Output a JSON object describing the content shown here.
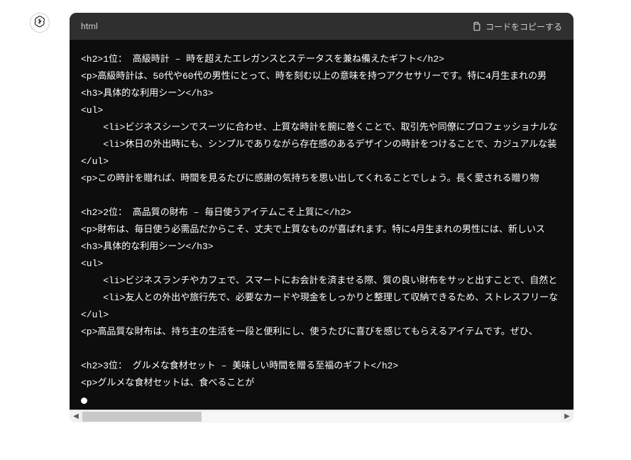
{
  "header": {
    "language": "html",
    "copy_label": "コードをコピーする"
  },
  "code": {
    "lines": [
      "<h2>1位： 高級時計 – 時を超えたエレガンスとステータスを兼ね備えたギフト</h2>",
      "<p>高級時計は、50代や60代の男性にとって、時を刻む以上の意味を持つアクセサリーです。特に4月生まれの男",
      "<h3>具体的な利用シーン</h3>",
      "<ul>",
      "    <li>ビジネスシーンでスーツに合わせ、上質な時計を腕に巻くことで、取引先や同僚にプロフェッショナルな",
      "    <li>休日の外出時にも、シンプルでありながら存在感のあるデザインの時計をつけることで、カジュアルな装",
      "</ul>",
      "<p>この時計を贈れば、時間を見るたびに感謝の気持ちを思い出してくれることでしょう。長く愛される贈り物",
      "",
      "<h2>2位： 高品質の財布 – 毎日使うアイテムこそ上質に</h2>",
      "<p>財布は、毎日使う必需品だからこそ、丈夫で上質なものが喜ばれます。特に4月生まれの男性には、新しいス",
      "<h3>具体的な利用シーン</h3>",
      "<ul>",
      "    <li>ビジネスランチやカフェで、スマートにお会計を済ませる際、質の良い財布をサッと出すことで、自然と",
      "    <li>友人との外出や旅行先で、必要なカードや現金をしっかりと整理して収納できるため、ストレスフリーな",
      "</ul>",
      "<p>高品質な財布は、持ち主の生活を一段と便利にし、使うたびに喜びを感じてもらえるアイテムです。ぜひ、",
      "",
      "<h2>3位： グルメな食材セット – 美味しい時間を贈る至福のギフト</h2>",
      "<p>グルメな食材セットは、食べることが"
    ]
  },
  "icons": {
    "assistant": "openai-logo-icon",
    "copy": "clipboard-icon",
    "arrow_left": "◀",
    "arrow_right": "▶"
  }
}
